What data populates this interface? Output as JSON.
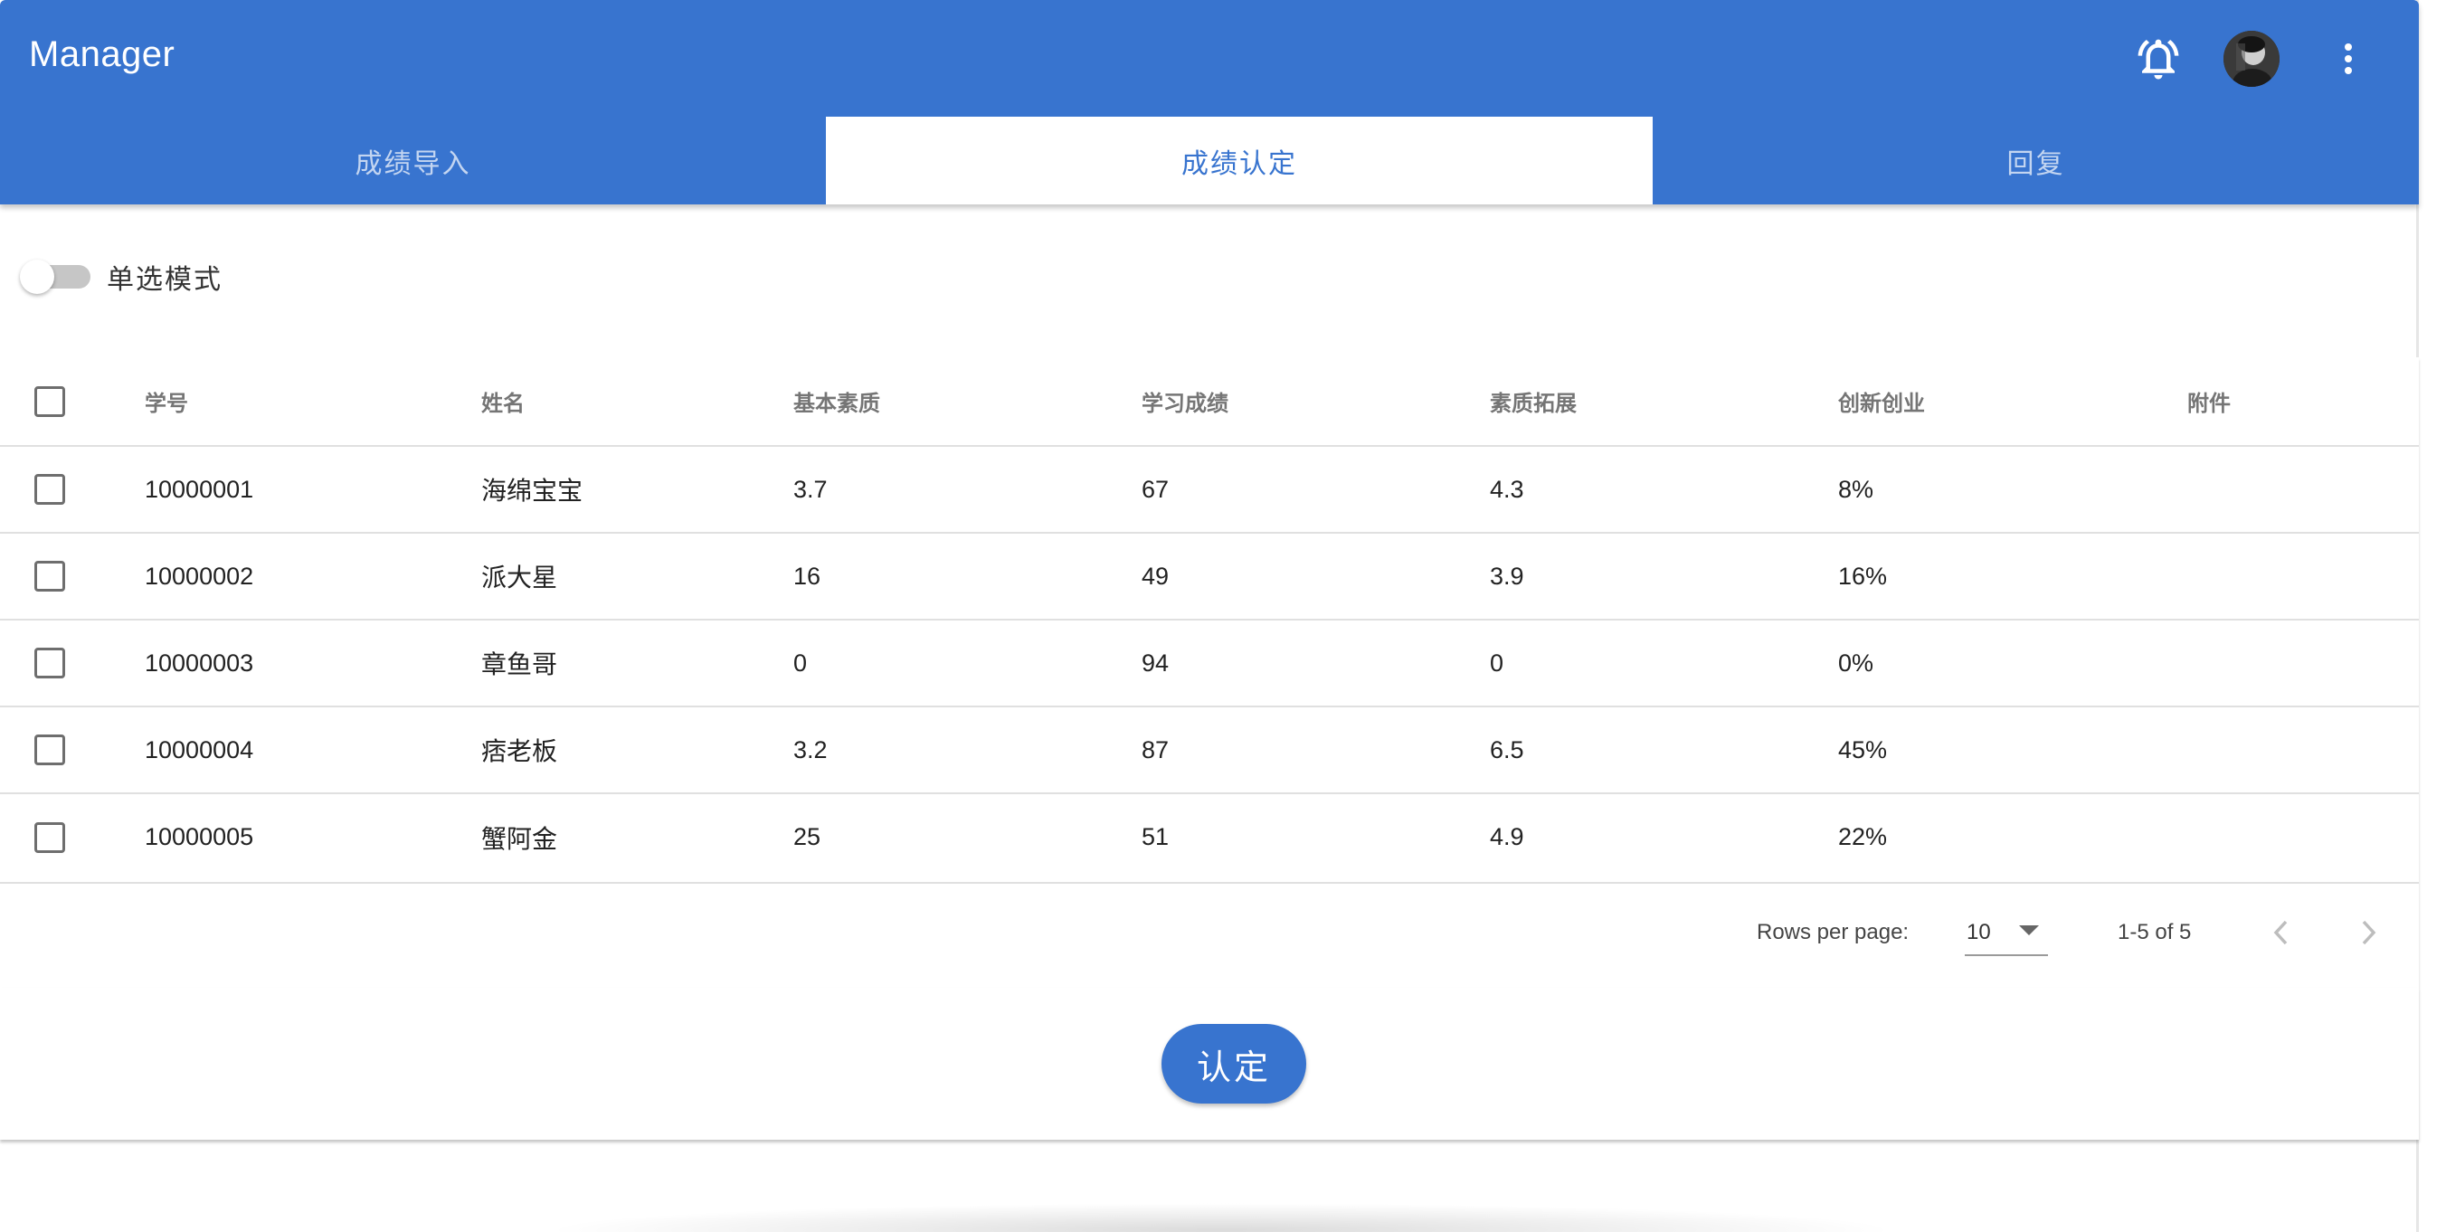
{
  "app": {
    "title": "Manager"
  },
  "header_icons": {
    "notification": "bell-ring-icon",
    "avatar": "user-avatar",
    "menu": "more-vertical-icon"
  },
  "tabs": [
    {
      "label": "成绩导入",
      "active": false
    },
    {
      "label": "成绩认定",
      "active": true
    },
    {
      "label": "回复",
      "active": false
    }
  ],
  "toggle": {
    "label": "单选模式",
    "on": false
  },
  "table": {
    "columns": [
      "学号",
      "姓名",
      "基本素质",
      "学习成绩",
      "素质拓展",
      "创新创业",
      "附件"
    ],
    "rows": [
      {
        "id": "10000001",
        "name": "海绵宝宝",
        "basic": "3.7",
        "study": "67",
        "expand": "4.3",
        "innovation": "8%",
        "attachment": ""
      },
      {
        "id": "10000002",
        "name": "派大星",
        "basic": "16",
        "study": "49",
        "expand": "3.9",
        "innovation": "16%",
        "attachment": ""
      },
      {
        "id": "10000003",
        "name": "章鱼哥",
        "basic": "0",
        "study": "94",
        "expand": "0",
        "innovation": "0%",
        "attachment": ""
      },
      {
        "id": "10000004",
        "name": "痞老板",
        "basic": "3.2",
        "study": "87",
        "expand": "6.5",
        "innovation": "45%",
        "attachment": ""
      },
      {
        "id": "10000005",
        "name": "蟹阿金",
        "basic": "25",
        "study": "51",
        "expand": "4.9",
        "innovation": "22%",
        "attachment": ""
      }
    ]
  },
  "pagination": {
    "rows_per_page_label": "Rows per page:",
    "rows_per_page_value": "10",
    "range": "1-5 of 5"
  },
  "actions": {
    "confirm_label": "认定"
  },
  "colors": {
    "primary": "#3874cf",
    "text": "#222222",
    "header_text": "#757575"
  }
}
